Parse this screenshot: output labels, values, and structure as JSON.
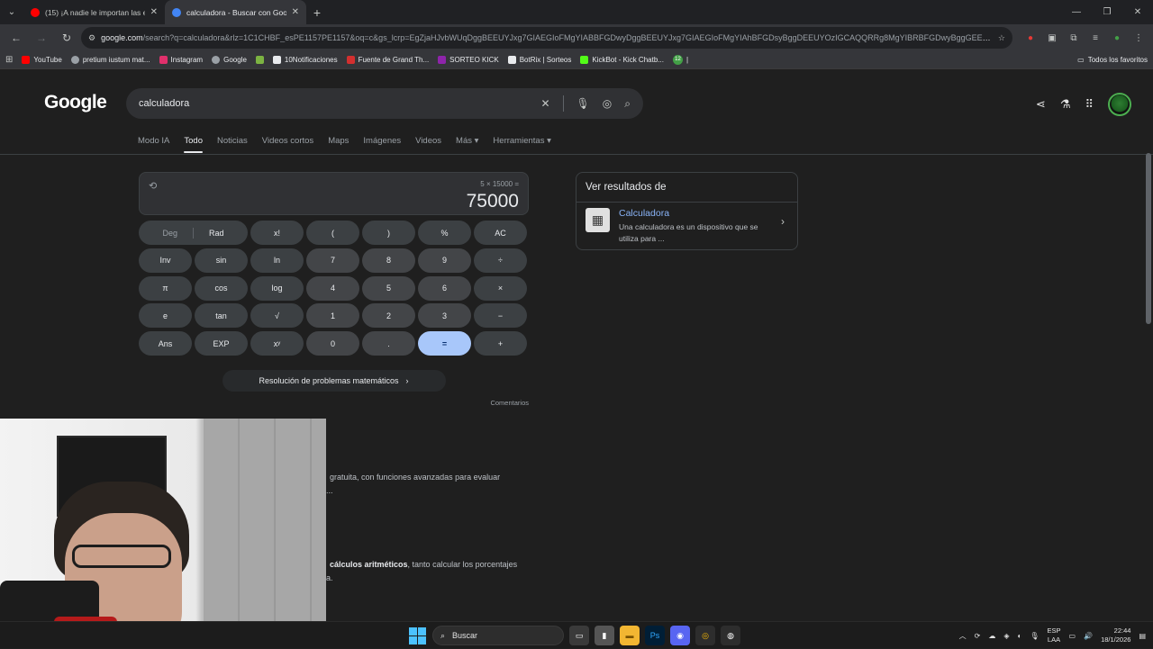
{
  "browser": {
    "tabs": [
      {
        "title": "(15) ¡A nadie le importan las ele",
        "favicon_color": "#ff0000"
      },
      {
        "title": "calculadora - Buscar con Googl",
        "favicon_color": "#4285f4"
      }
    ],
    "url_host": "google.com",
    "url_rest": "/search?q=calculadora&rlz=1C1CHBF_esPE1157PE1157&oq=c&gs_lcrp=EgZjaHJvbWUqDggBEEUYJxg7GIAEGIoFMgYIABBFGDwyDggBEEUYJxg7GIAEGIoFMgYIAhBFGDsyBggDEEUYOzIGCAQQRRg8MgYIBRBFGDwyBggGEEUYP...",
    "bookmarks": [
      {
        "label": "YouTube",
        "color": "#ff0000"
      },
      {
        "label": "pretium iustum mat...",
        "color": "#9aa0a6"
      },
      {
        "label": "Instagram",
        "color": "#e1306c"
      },
      {
        "label": "Google",
        "color": "#9aa0a6"
      },
      {
        "label": "",
        "color": "#7cb342"
      },
      {
        "label": "10Notificaciones",
        "color": "#e8eaed"
      },
      {
        "label": "Fuente de Grand Th...",
        "color": "#d32f2f"
      },
      {
        "label": "SORTEO KICK",
        "color": "#8e24aa"
      },
      {
        "label": "BotRix | Sorteos",
        "color": "#e8eaed"
      },
      {
        "label": "KickBot - Kick Chatb...",
        "color": "#53fc18"
      },
      {
        "label": "12",
        "color": "#43a047"
      }
    ],
    "bookmarks_all": "Todos los favoritos"
  },
  "search": {
    "logo": "Google",
    "query": "calculadora",
    "tabs": [
      "Modo IA",
      "Todo",
      "Noticias",
      "Videos cortos",
      "Maps",
      "Imágenes",
      "Videos",
      "Más",
      "Herramientas"
    ],
    "active_tab": "Todo"
  },
  "calculator": {
    "expression": "5 × 15000 =",
    "result": "75000",
    "keys": {
      "deg": "Deg",
      "rad": "Rad",
      "fact": "x!",
      "lparen": "(",
      "rparen": ")",
      "pct": "%",
      "ac": "AC",
      "inv": "Inv",
      "sin": "sin",
      "ln": "ln",
      "n7": "7",
      "n8": "8",
      "n9": "9",
      "div": "÷",
      "pi": "π",
      "cos": "cos",
      "log": "log",
      "n4": "4",
      "n5": "5",
      "n6": "6",
      "mul": "×",
      "e": "e",
      "tan": "tan",
      "sqrt": "√",
      "n1": "1",
      "n2": "2",
      "n3": "3",
      "sub": "−",
      "ans": "Ans",
      "exp": "EXP",
      "pow": "xʸ",
      "n0": "0",
      "dot": ".",
      "eq": "=",
      "add": "+"
    },
    "more_label": "Resolución de problemas matemáticos",
    "feedback": "Comentarios"
  },
  "knowledge_panel": {
    "heading": "Ver resultados de",
    "title": "Calculadora",
    "description": "Una calculadora es un dispositivo que se utiliza para ..."
  },
  "results": {
    "snippet1": "gratuita, con funciones avanzadas para evaluar",
    "snippet1b": "...",
    "snippet2_bold": "cálculos aritméticos",
    "snippet2_rest": ", tanto calcular los porcentajes",
    "snippet2b": "a."
  },
  "taskbar": {
    "search": "Buscar",
    "lang1": "ESP",
    "lang2": "LAA",
    "time": "22:44",
    "date": "18/1/2026"
  }
}
